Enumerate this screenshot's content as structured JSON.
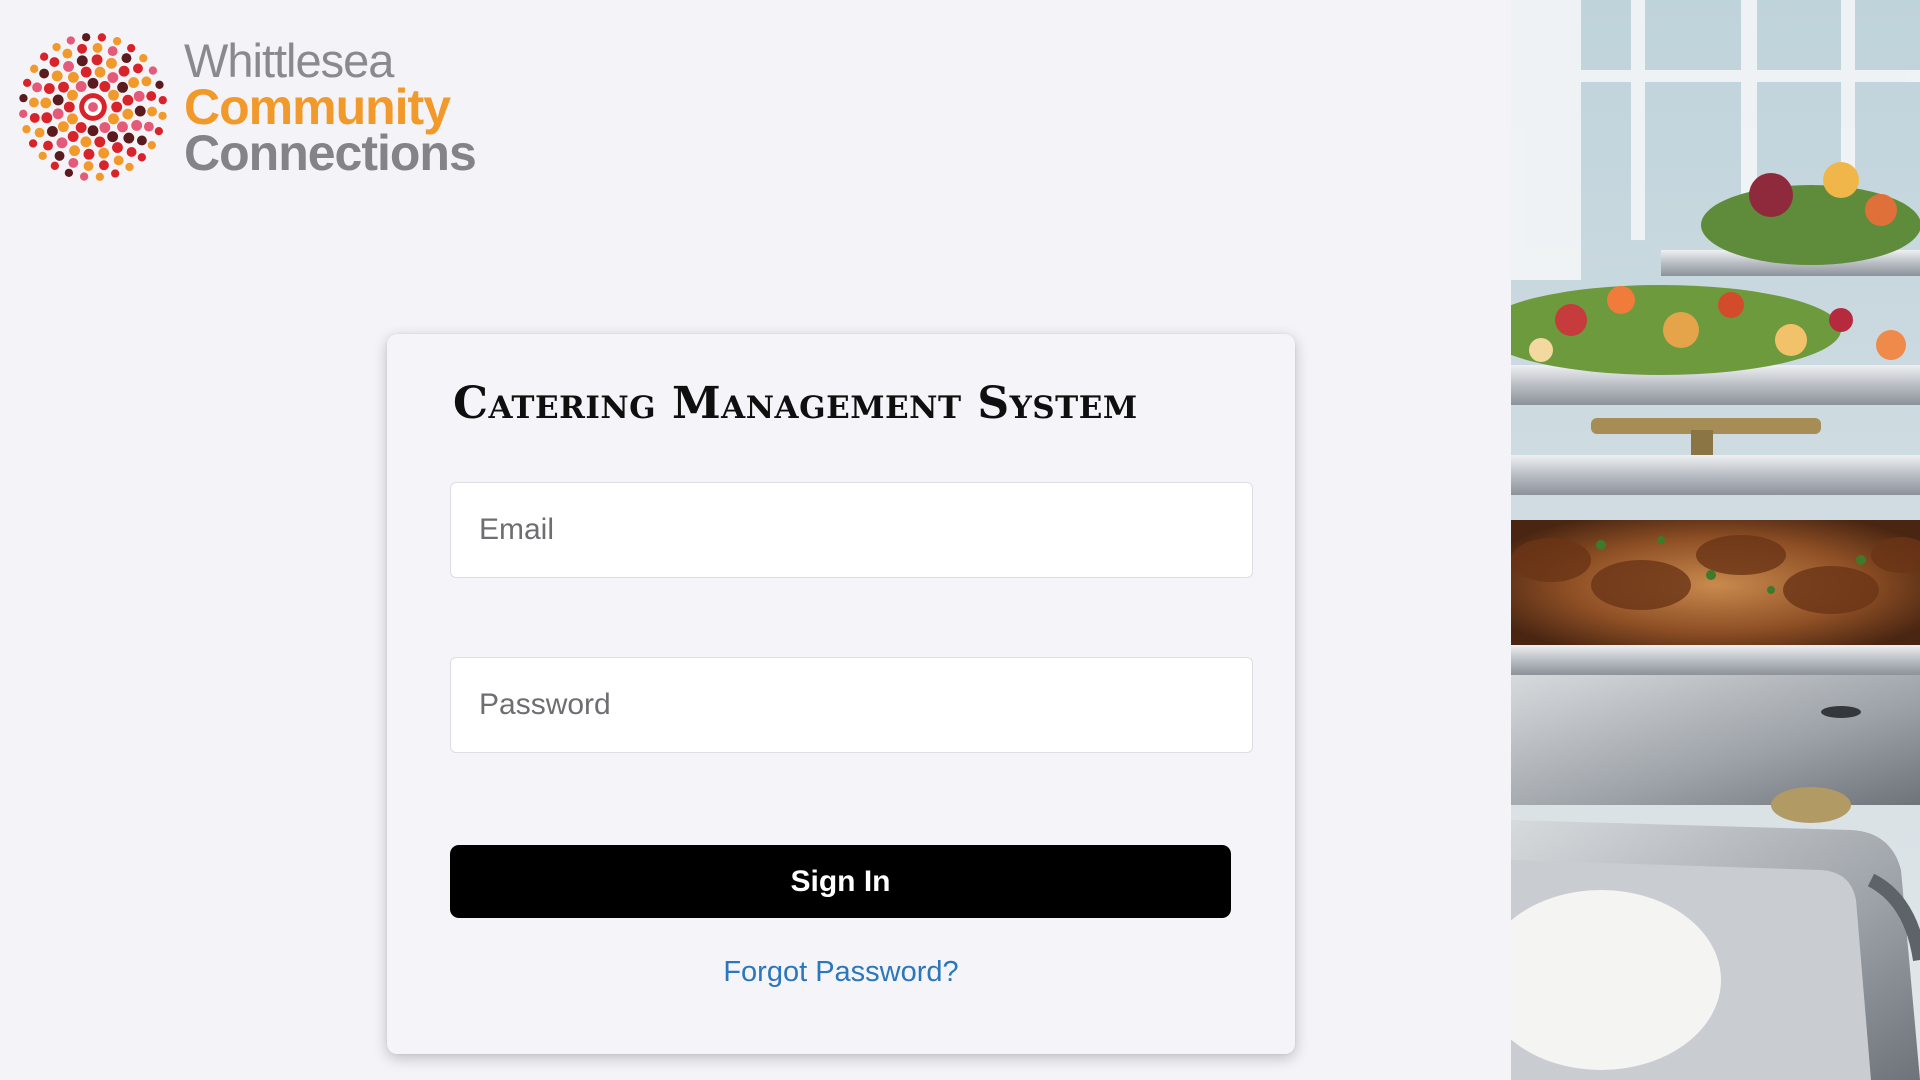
{
  "logo": {
    "line1": "Whittlesea",
    "line2": "Community",
    "line3": "Connections",
    "colors": {
      "orange": "#f19a2b",
      "grey": "#848487",
      "red": "#d8232a",
      "maroon": "#5b1a1d",
      "pink": "#e45a78"
    }
  },
  "login": {
    "title": "Catering Management System",
    "email": {
      "placeholder": "Email",
      "value": ""
    },
    "password": {
      "placeholder": "Password",
      "value": ""
    },
    "signin_label": "Sign In",
    "forgot_label": "Forgot Password?"
  },
  "theme": {
    "background": "#f4f3f7",
    "button": "#000000",
    "link": "#2a77bd"
  },
  "icons": [
    "logo-sunburst-icon"
  ]
}
